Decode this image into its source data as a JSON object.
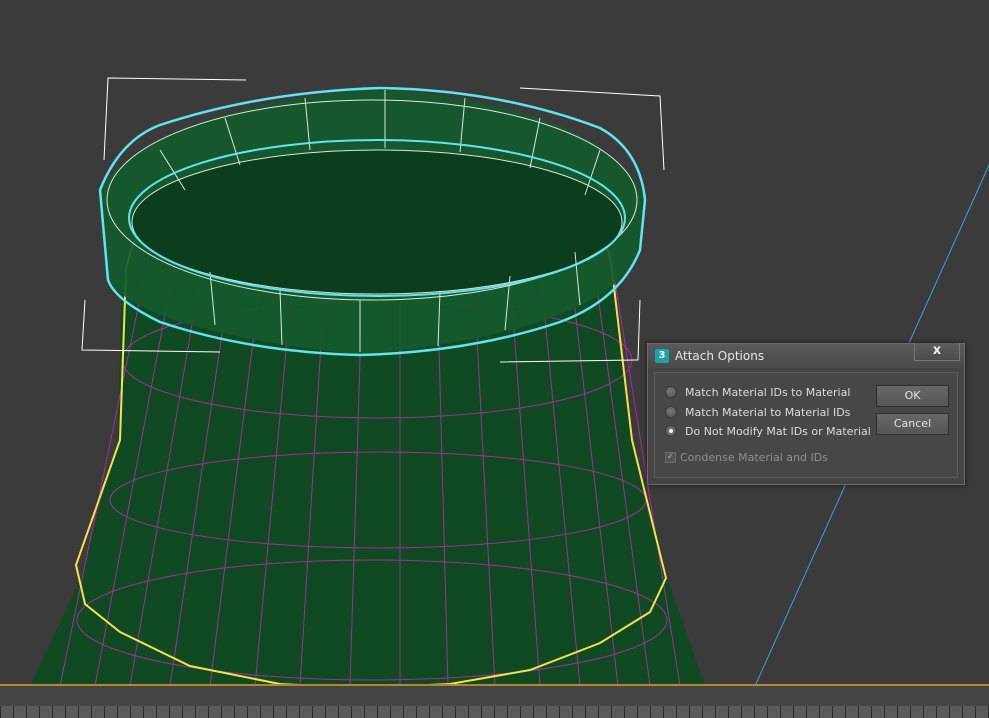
{
  "dialog": {
    "title": "Attach Options",
    "app_icon_glyph": "3",
    "close_glyph": "x",
    "options": [
      {
        "label": "Match Material IDs to Material",
        "checked": false
      },
      {
        "label": "Match Material to Material IDs",
        "checked": false
      },
      {
        "label": "Do Not Modify Mat IDs or Material",
        "checked": true
      }
    ],
    "condense_label": "Condense Material and IDs",
    "condense_checked": true,
    "condense_enabled": false,
    "ok_label": "OK",
    "cancel_label": "Cancel"
  },
  "viewport": {
    "background": "#3b3b3b",
    "mesh_fill": "#0f4a22",
    "mesh_wire": "#a0309a",
    "ring_selection": "#5fe4f0",
    "base_selection": "#f5e24a",
    "bbox_color": "#ffffff",
    "line_color": "#3aa3d6"
  },
  "timeline": {
    "accent": "#b08a2a"
  }
}
